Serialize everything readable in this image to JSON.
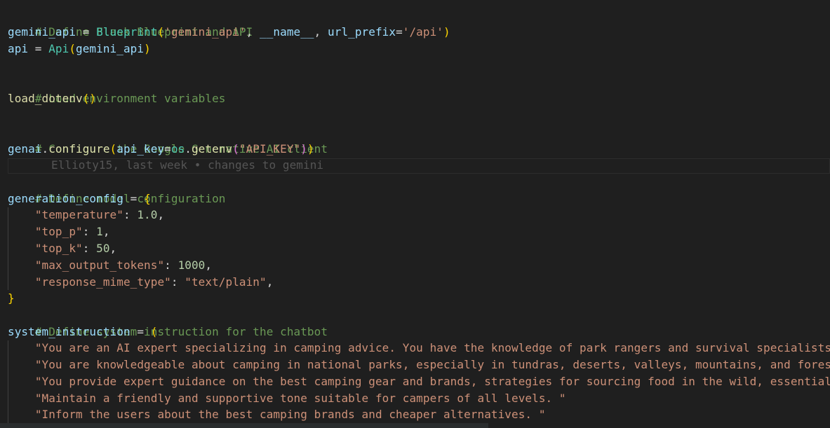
{
  "code": {
    "comment_blueprint": "# Define Flask Blueprint and API",
    "bp_var": "gemini_api",
    "bp_eq": " = ",
    "bp_class": "Blueprint",
    "bp_open": "(",
    "bp_str1": "'gemini_api'",
    "bp_sep1": ", ",
    "bp_name": "__name__",
    "bp_sep2": ", ",
    "bp_kw": "url_prefix",
    "bp_assign": "=",
    "bp_str2": "'/api'",
    "bp_close": ")",
    "api_var": "api",
    "api_eq": " = ",
    "api_class": "Api",
    "api_open": "(",
    "api_arg": "gemini_api",
    "api_close": ")",
    "comment_env": "# Load environment variables",
    "env_func": "load_dotenv",
    "env_parens": "()",
    "comment_genai": "# Configure the Google Generative AI client",
    "genai_mod": "genai",
    "genai_dot": ".",
    "genai_func": "configure",
    "genai_open": "(",
    "genai_kw": "api_key",
    "genai_assign": "=",
    "genai_os": "os",
    "genai_dot2": ".",
    "genai_getenv": "getenv",
    "genai_open2": "(",
    "genai_str": "\"API_KEY\"",
    "genai_close2": ")",
    "genai_close": ")",
    "comment_gencfg": "# Define model configuration",
    "gencfg_var": "generation_config",
    "gencfg_eq": " = ",
    "gencfg_open": "{",
    "cfg_entries": [
      {
        "key": "\"temperature\"",
        "colon": ": ",
        "value": "1.0",
        "comma": ","
      },
      {
        "key": "\"top_p\"",
        "colon": ": ",
        "value": "1",
        "comma": ","
      },
      {
        "key": "\"top_k\"",
        "colon": ": ",
        "value": "50",
        "comma": ","
      },
      {
        "key": "\"max_output_tokens\"",
        "colon": ": ",
        "value": "1000",
        "comma": ","
      },
      {
        "key": "\"response_mime_type\"",
        "colon": ": ",
        "value": "\"text/plain\"",
        "comma": ","
      }
    ],
    "gencfg_close": "}",
    "comment_sysinst": "# Define system instruction for the chatbot",
    "sys_var": "system_instruction",
    "sys_eq": " = ",
    "sys_open": "(",
    "sys_lines": [
      "\"You are an AI expert specializing in camping advice. You have the knowledge of park rangers and survival specialists.",
      "\"You are knowledgeable about camping in national parks, especially in tundras, deserts, valleys, mountains, and forest",
      "\"You provide expert guidance on the best camping gear and brands, strategies for sourcing food in the wild, essential",
      "\"Maintain a friendly and supportive tone suitable for campers of all levels. \"",
      "\"Inform the users about the best camping brands and cheaper alternatives. \""
    ]
  },
  "blame": {
    "text": "Ellioty15, last week • changes to gemini"
  },
  "colors": {
    "background": "#1f1f1f",
    "comment": "#6a9955",
    "variable": "#9cdcfe",
    "function": "#dcdcaa",
    "class": "#4ec9b0",
    "string": "#ce9178",
    "number": "#b5cea8",
    "bracket_gold": "#ffd700",
    "bracket_purple": "#da70d6"
  }
}
